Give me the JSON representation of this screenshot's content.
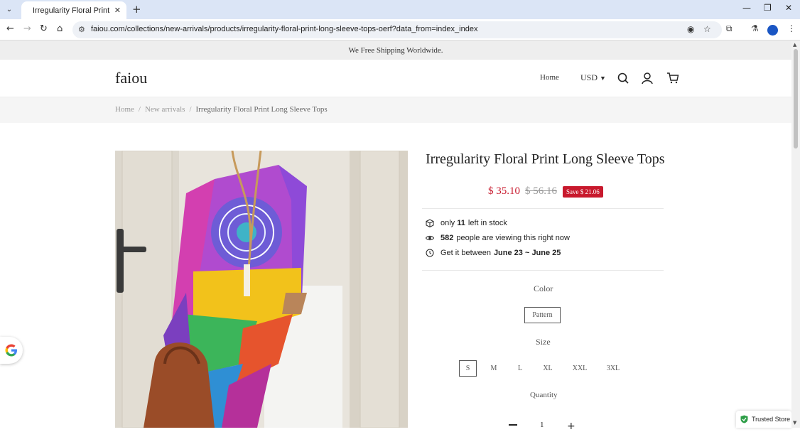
{
  "browser": {
    "tab_title": "Irregularity Floral Print Long Sle",
    "url": "faiou.com/collections/new-arrivals/products/irregularity-floral-print-long-sleeve-tops-oerf?data_from=index_index"
  },
  "announcement": "We Free Shipping Worldwide.",
  "header": {
    "logo": "faiou",
    "nav_home": "Home",
    "currency": "USD"
  },
  "breadcrumb": {
    "home": "Home",
    "category": "New arrivals",
    "current": "Irregularity Floral Print Long Sleeve Tops",
    "separator": "/"
  },
  "product": {
    "title": "Irregularity Floral Print Long Sleeve Tops",
    "price": "$ 35.10",
    "old_price": "$ 56.16",
    "save_label": "Save $ 21.06",
    "stock": {
      "prefix": "only",
      "count": "11",
      "suffix": "left in stock"
    },
    "viewers": {
      "count": "582",
      "suffix": "people are viewing this right now"
    },
    "delivery": {
      "prefix": "Get it between",
      "range": "June 23 ~ June 25"
    },
    "color_label": "Color",
    "colors": [
      "Pattern"
    ],
    "size_label": "Size",
    "sizes": [
      "S",
      "M",
      "L",
      "XL",
      "XXL",
      "3XL"
    ],
    "selected_size": "S",
    "quantity_label": "Quantity",
    "quantity": "1"
  },
  "trusted_store": "Trusted Store",
  "colors": {
    "price_red": "#c8192d",
    "announce_bg": "#eeeeee",
    "tabbar_bg": "#dbe5f6"
  }
}
